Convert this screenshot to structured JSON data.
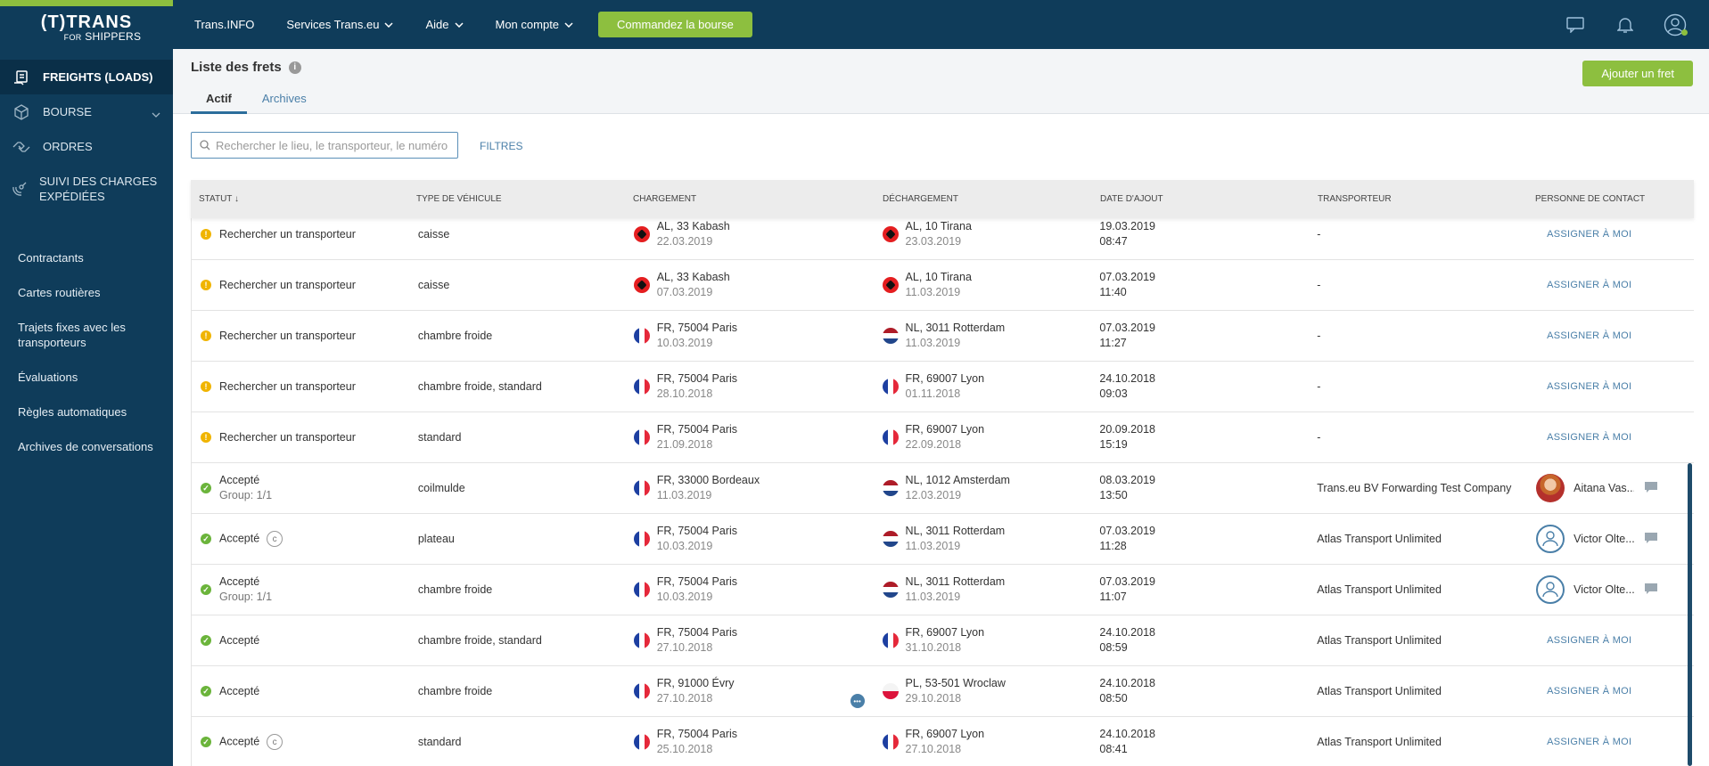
{
  "brand": {
    "line1": "(T)TRANS",
    "line2a": "FOR",
    "line2b": "SHIPPERS",
    "accent": "#8dbf3f",
    "navy": "#0f3c5a"
  },
  "sidebar": {
    "main": [
      {
        "label": "FREIGHTS (LOADS)",
        "icon": "clipboard-icon"
      },
      {
        "label": "BOURSE",
        "icon": "box-icon"
      },
      {
        "label": "ORDRES",
        "icon": "handshake-icon"
      },
      {
        "label": "SUIVI DES CHARGES EXPÉDIÉES",
        "icon": "satellite-icon"
      }
    ],
    "sub": [
      "Contractants",
      "Cartes routières",
      "Trajets fixes avec les transporteurs",
      "Évaluations",
      "Règles automatiques",
      "Archives de conversations"
    ]
  },
  "header": {
    "nav": [
      "Trans.INFO",
      "Services Trans.eu",
      "Aide",
      "Mon compte"
    ],
    "cta": "Commandez la bourse"
  },
  "page": {
    "title": "Liste des frets",
    "tabs": [
      "Actif",
      "Archives"
    ],
    "add_button": "Ajouter un fret",
    "search_placeholder": "Rechercher le lieu, le transporteur, le numéro de",
    "filters": "FILTRES"
  },
  "table": {
    "columns": [
      "STATUT",
      "TYPE DE VÉHICULE",
      "CHARGEMENT",
      "DÉCHARGEMENT",
      "DATE D'AJOUT",
      "TRANSPORTEUR",
      "PERSONNE DE CONTACT"
    ],
    "rows": [
      {
        "status": "Rechercher un transporteur",
        "state": "warn",
        "vehicle": "caisse",
        "load_flag": "al",
        "load": "AL, 33 Kabash",
        "load_date": "22.03.2019",
        "unload_flag": "al",
        "unload": "AL, 10 Tirana",
        "unload_date": "23.03.2019",
        "added_date": "19.03.2019",
        "added_time": "08:47",
        "carrier": "-",
        "contact": "ASSIGNER À MOI"
      },
      {
        "status": "Rechercher un transporteur",
        "state": "warn",
        "vehicle": "caisse",
        "load_flag": "al",
        "load": "AL, 33 Kabash",
        "load_date": "07.03.2019",
        "unload_flag": "al",
        "unload": "AL, 10 Tirana",
        "unload_date": "11.03.2019",
        "added_date": "07.03.2019",
        "added_time": "11:40",
        "carrier": "-",
        "contact": "ASSIGNER À MOI"
      },
      {
        "status": "Rechercher un transporteur",
        "state": "warn",
        "vehicle": "chambre froide",
        "load_flag": "fr",
        "load": "FR, 75004 Paris",
        "load_date": "10.03.2019",
        "unload_flag": "nl",
        "unload": "NL, 3011 Rotterdam",
        "unload_date": "11.03.2019",
        "added_date": "07.03.2019",
        "added_time": "11:27",
        "carrier": "-",
        "contact": "ASSIGNER À MOI"
      },
      {
        "status": "Rechercher un transporteur",
        "state": "warn",
        "vehicle": "chambre froide, standard",
        "load_flag": "fr",
        "load": "FR, 75004 Paris",
        "load_date": "28.10.2018",
        "unload_flag": "fr",
        "unload": "FR, 69007 Lyon",
        "unload_date": "01.11.2018",
        "added_date": "24.10.2018",
        "added_time": "09:03",
        "carrier": "-",
        "contact": "ASSIGNER À MOI"
      },
      {
        "status": "Rechercher un transporteur",
        "state": "warn",
        "vehicle": "standard",
        "load_flag": "fr",
        "load": "FR, 75004 Paris",
        "load_date": "21.09.2018",
        "unload_flag": "fr",
        "unload": "FR, 69007 Lyon",
        "unload_date": "22.09.2018",
        "added_date": "20.09.2018",
        "added_time": "15:19",
        "carrier": "-",
        "contact": "ASSIGNER À MOI"
      },
      {
        "status": "Accepté",
        "status_sub": "Group: 1/1",
        "state": "ok",
        "vehicle": "coilmulde",
        "load_flag": "fr",
        "load": "FR, 33000 Bordeaux",
        "load_date": "11.03.2019",
        "unload_flag": "nl",
        "unload": "NL, 1012 Amsterdam",
        "unload_date": "12.03.2019",
        "added_date": "08.03.2019",
        "added_time": "13:50",
        "carrier": "Trans.eu BV Forwarding Test Company",
        "contact_name": "Aitana Vas...",
        "avatar": "photo"
      },
      {
        "status": "Accepté",
        "badge": "c",
        "state": "ok",
        "vehicle": "plateau",
        "load_flag": "fr",
        "load": "FR, 75004 Paris",
        "load_date": "10.03.2019",
        "unload_flag": "nl",
        "unload": "NL, 3011 Rotterdam",
        "unload_date": "11.03.2019",
        "added_date": "07.03.2019",
        "added_time": "11:28",
        "carrier": "Atlas Transport Unlimited",
        "contact_name": "Victor Olte...",
        "avatar": "empty"
      },
      {
        "status": "Accepté",
        "status_sub": "Group: 1/1",
        "state": "ok",
        "vehicle": "chambre froide",
        "load_flag": "fr",
        "load": "FR, 75004 Paris",
        "load_date": "10.03.2019",
        "unload_flag": "nl",
        "unload": "NL, 3011 Rotterdam",
        "unload_date": "11.03.2019",
        "added_date": "07.03.2019",
        "added_time": "11:07",
        "carrier": "Atlas Transport Unlimited",
        "contact_name": "Victor Olte...",
        "avatar": "empty"
      },
      {
        "status": "Accepté",
        "state": "ok",
        "vehicle": "chambre froide, standard",
        "load_flag": "fr",
        "load": "FR, 75004 Paris",
        "load_date": "27.10.2018",
        "unload_flag": "fr",
        "unload": "FR, 69007 Lyon",
        "unload_date": "31.10.2018",
        "added_date": "24.10.2018",
        "added_time": "08:59",
        "carrier": "Atlas Transport Unlimited",
        "contact": "ASSIGNER À MOI"
      },
      {
        "status": "Accepté",
        "state": "ok",
        "vehicle": "chambre froide",
        "load_flag": "fr",
        "load": "FR, 91000 Évry",
        "load_date": "27.10.2018",
        "more": true,
        "unload_flag": "pl",
        "unload": "PL, 53-501 Wroclaw",
        "unload_date": "29.10.2018",
        "added_date": "24.10.2018",
        "added_time": "08:50",
        "carrier": "Atlas Transport Unlimited",
        "contact": "ASSIGNER À MOI"
      },
      {
        "status": "Accepté",
        "badge": "c",
        "state": "ok",
        "vehicle": "standard",
        "load_flag": "fr",
        "load": "FR, 75004 Paris",
        "load_date": "25.10.2018",
        "unload_flag": "fr",
        "unload": "FR, 69007 Lyon",
        "unload_date": "27.10.2018",
        "added_date": "24.10.2018",
        "added_time": "08:41",
        "carrier": "Atlas Transport Unlimited",
        "contact": "ASSIGNER À MOI"
      }
    ]
  }
}
